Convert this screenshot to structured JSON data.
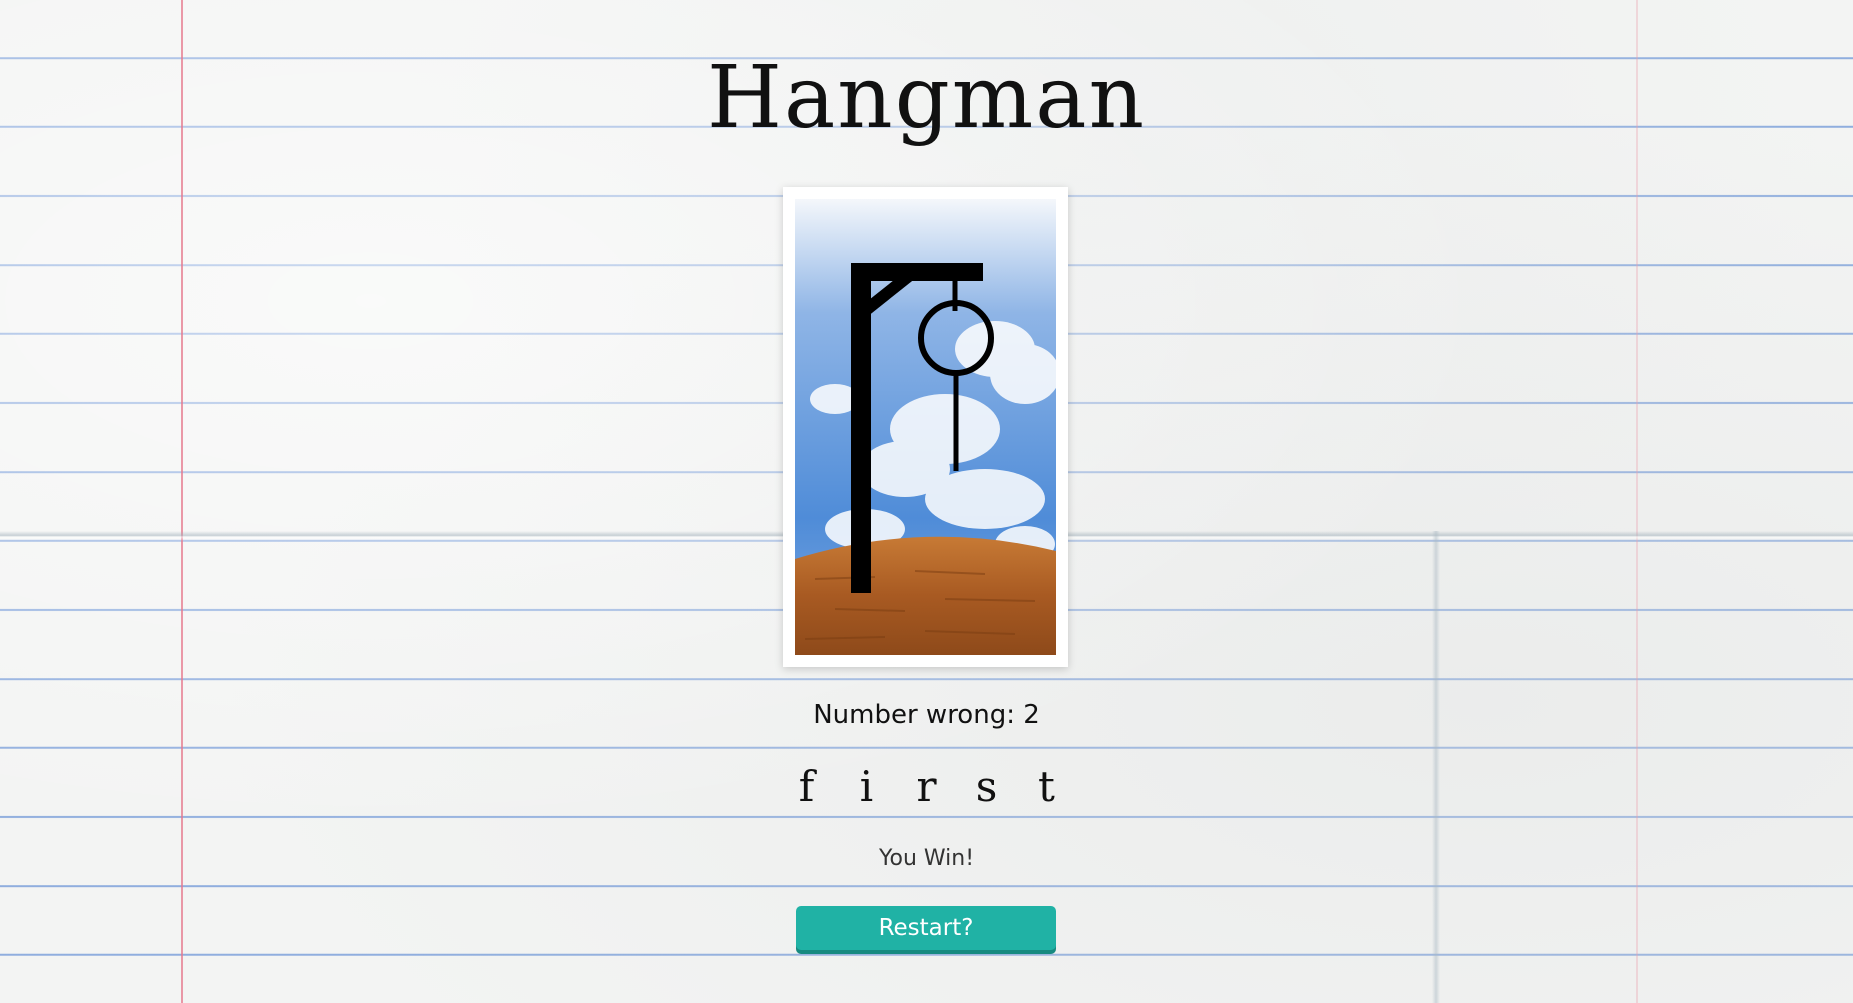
{
  "title": "Hangman",
  "game": {
    "wrong_label": "Number wrong: 2",
    "wrong_count": 2,
    "word_letters": [
      "f",
      "i",
      "r",
      "s",
      "t"
    ],
    "status": "You Win!",
    "restart_label": "Restart?"
  },
  "colors": {
    "button": "#20b2a5",
    "button_shadow": "#178a80",
    "sky": "#5f97d8",
    "ground": "#b8652a",
    "gallows": "#000000"
  }
}
